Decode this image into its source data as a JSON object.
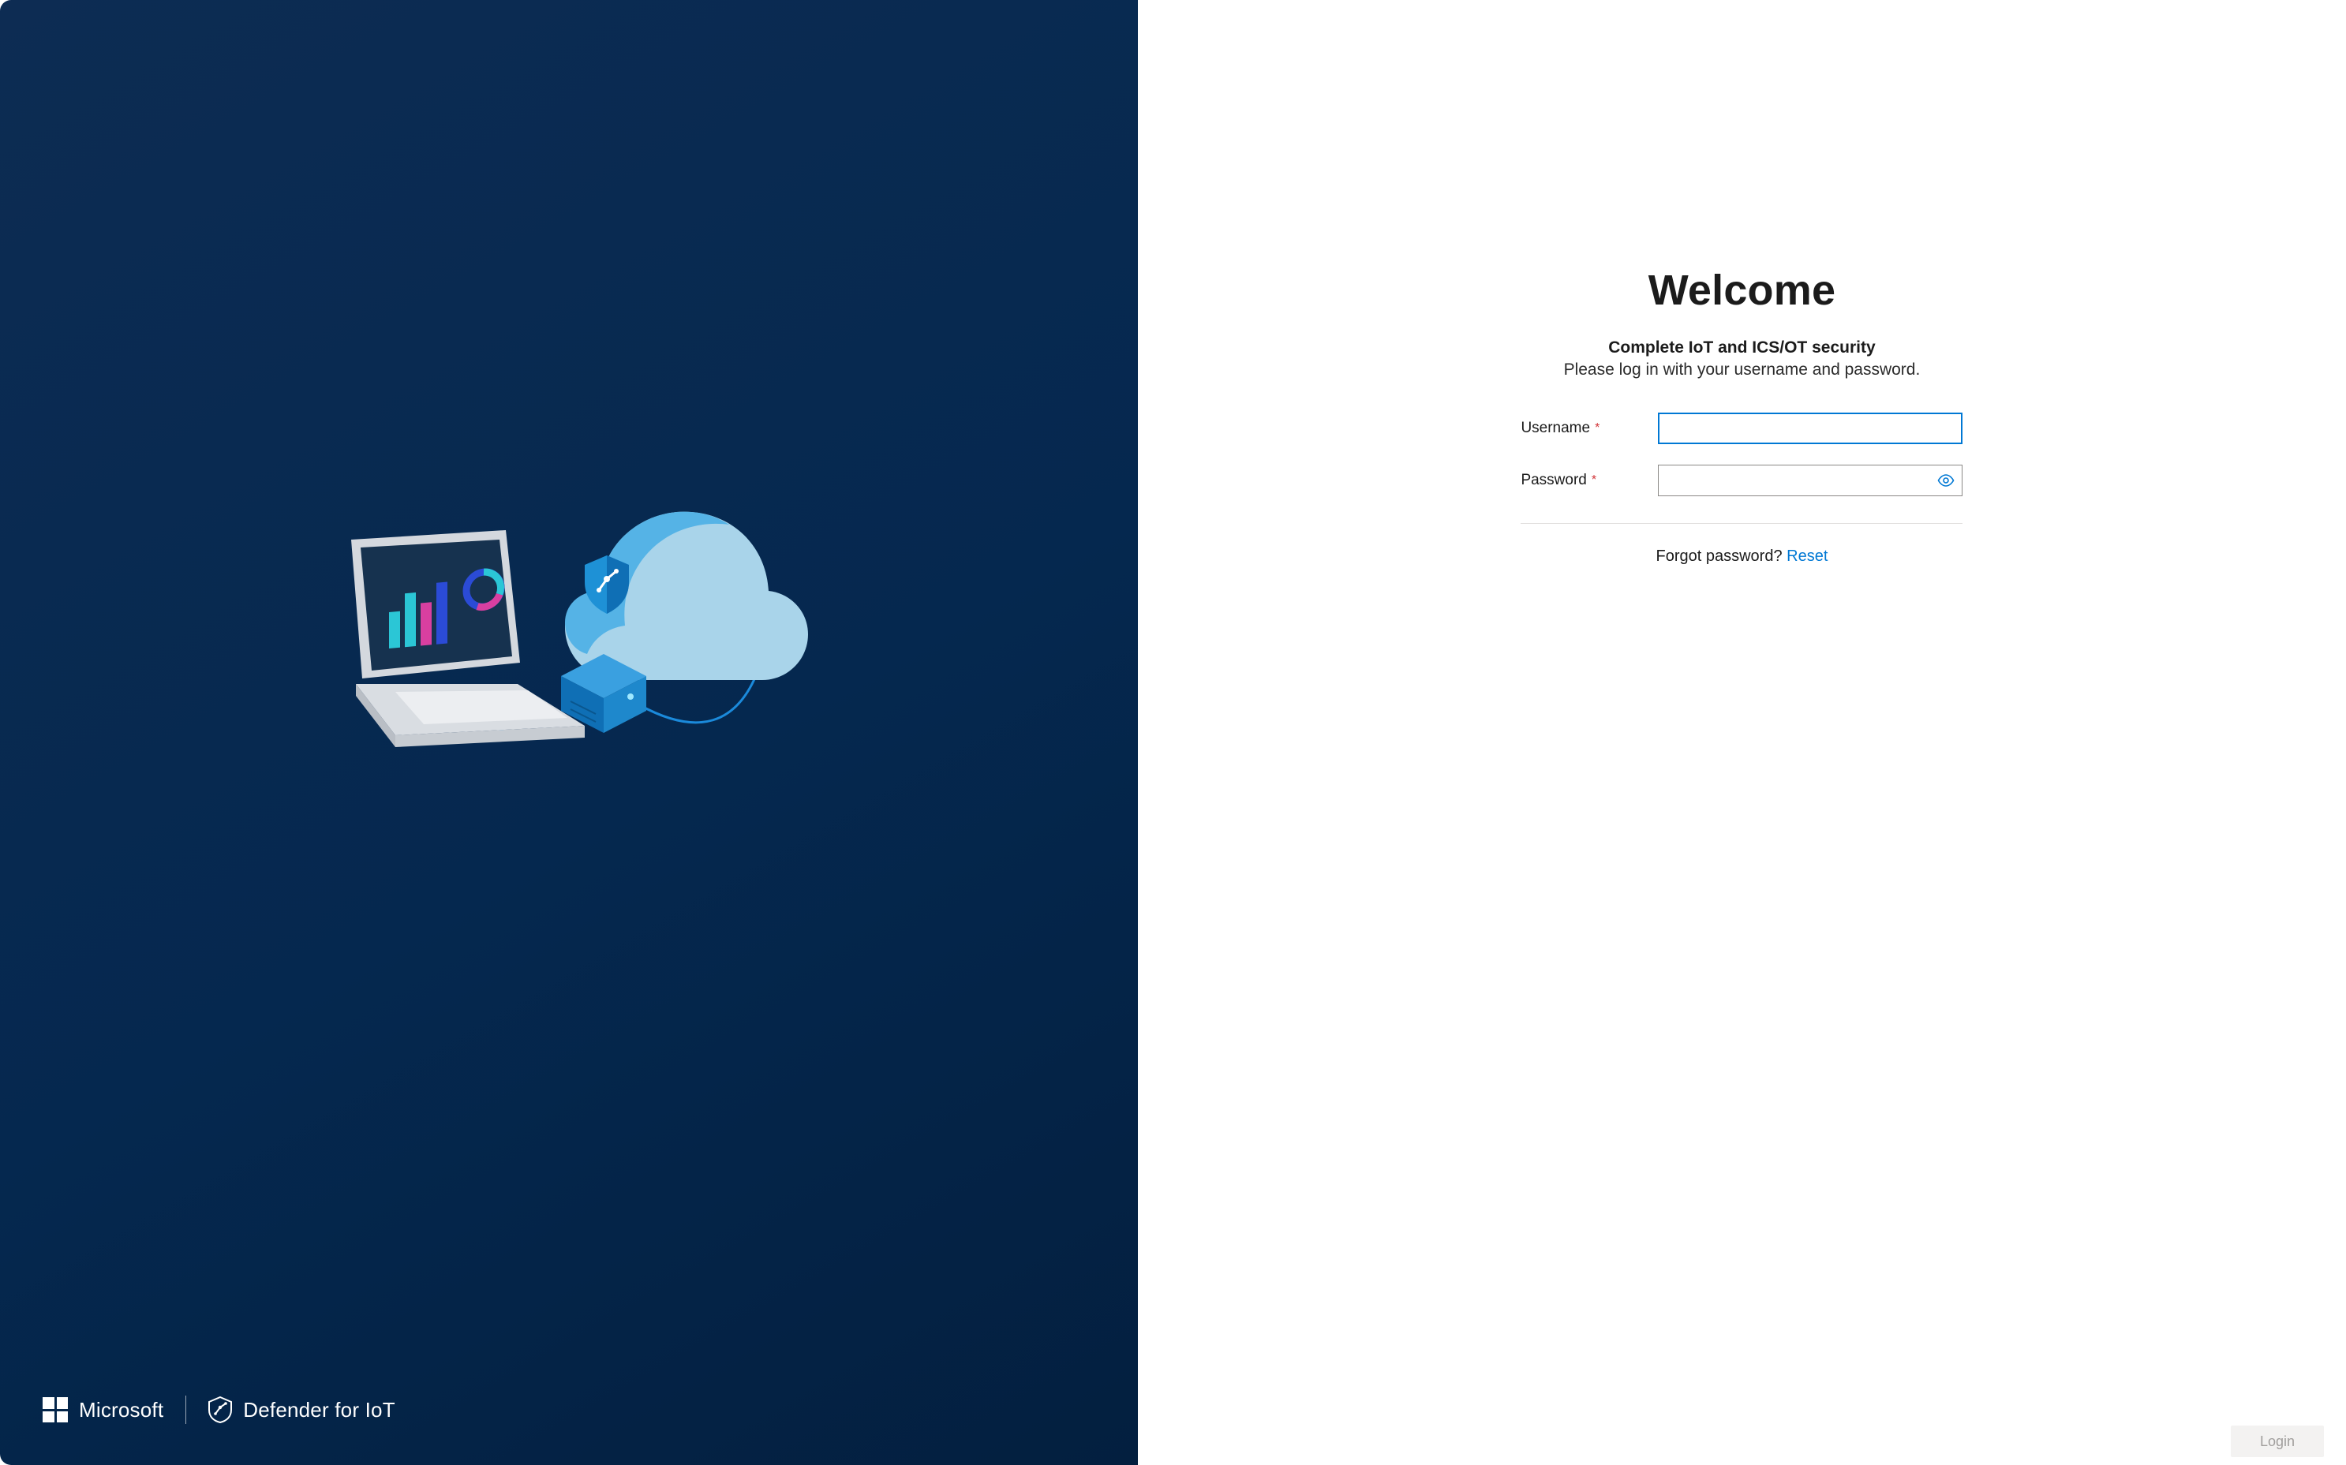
{
  "brand": {
    "company": "Microsoft",
    "product": "Defender for IoT"
  },
  "login": {
    "title": "Welcome",
    "subtitle_bold": "Complete IoT and ICS/OT security",
    "subtitle_text": "Please log in with your username and password.",
    "username_label": "Username",
    "password_label": "Password",
    "required_mark": "*",
    "username_value": "",
    "password_value": "",
    "forgot_text": "Forgot password? ",
    "reset_link": "Reset",
    "login_button": "Login"
  },
  "colors": {
    "primary": "#0078d4",
    "danger": "#d13438",
    "bg_dark": "#05284f"
  }
}
